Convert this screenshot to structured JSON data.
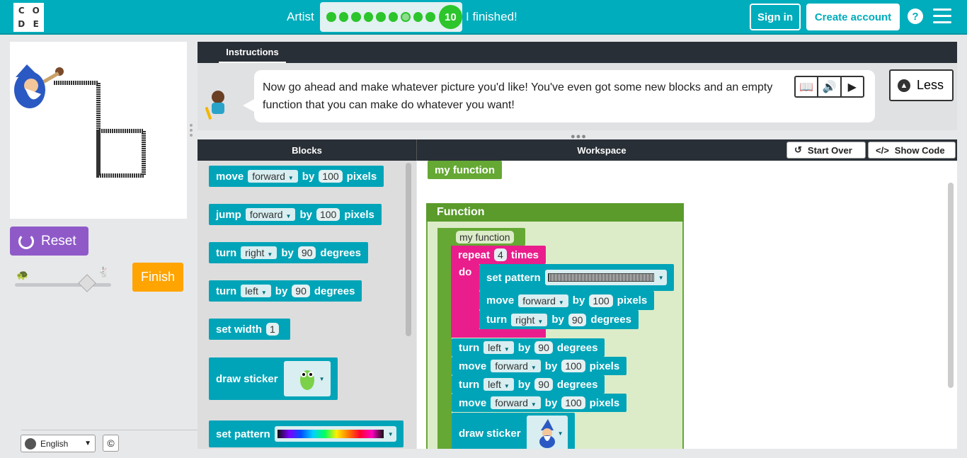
{
  "header": {
    "logo_letters": [
      "C",
      "O",
      "D",
      "E"
    ],
    "level_name": "Artist",
    "progress_current": "10",
    "finished_label": "I finished!",
    "signin_label": "Sign in",
    "create_label": "Create account",
    "help_label": "?"
  },
  "left": {
    "reset_label": "Reset",
    "finish_label": "Finish",
    "language": "English",
    "copyright": "©"
  },
  "instructions": {
    "tab_label": "Instructions",
    "text": "Now go ahead and make whatever picture you'd like! You've even got some new blocks and an empty function that you can make do whatever you want!",
    "less_label": "Less"
  },
  "workspace": {
    "blocks_title": "Blocks",
    "workspace_title": "Workspace",
    "start_over": "Start Over",
    "show_code": "Show Code"
  },
  "toolbox": {
    "move": {
      "verb": "move",
      "dir": "forward",
      "by": "by",
      "num": "100",
      "unit": "pixels"
    },
    "jump": {
      "verb": "jump",
      "dir": "forward",
      "by": "by",
      "num": "100",
      "unit": "pixels"
    },
    "turn_right": {
      "verb": "turn",
      "dir": "right",
      "by": "by",
      "num": "90",
      "unit": "degrees"
    },
    "turn_left": {
      "verb": "turn",
      "dir": "left",
      "by": "by",
      "num": "90",
      "unit": "degrees"
    },
    "set_width": {
      "verb": "set width",
      "num": "1"
    },
    "draw_sticker": "draw sticker",
    "set_pattern": "set pattern"
  },
  "function": {
    "call_label": "my function",
    "frame_title": "Function",
    "def_label": "my function",
    "repeat": "repeat",
    "repeat_num": "4",
    "times": "times",
    "do": "do",
    "set_pattern": "set pattern",
    "inner_move": {
      "verb": "move",
      "dir": "forward",
      "by": "by",
      "num": "100",
      "unit": "pixels"
    },
    "inner_turn": {
      "verb": "turn",
      "dir": "right",
      "by": "by",
      "num": "90",
      "unit": "degrees"
    },
    "after": [
      {
        "verb": "turn",
        "dir": "left",
        "by": "by",
        "num": "90",
        "unit": "degrees"
      },
      {
        "verb": "move",
        "dir": "forward",
        "by": "by",
        "num": "100",
        "unit": "pixels"
      },
      {
        "verb": "turn",
        "dir": "left",
        "by": "by",
        "num": "90",
        "unit": "degrees"
      },
      {
        "verb": "move",
        "dir": "forward",
        "by": "by",
        "num": "100",
        "unit": "pixels"
      }
    ],
    "draw_sticker": "draw sticker"
  },
  "colors": {
    "header": "#00adbc",
    "block_teal": "#00a4b8",
    "function_green": "#65a834",
    "repeat_pink": "#e91e8c",
    "reset_purple": "#8f5ac8",
    "finish_orange": "#ffa400"
  }
}
